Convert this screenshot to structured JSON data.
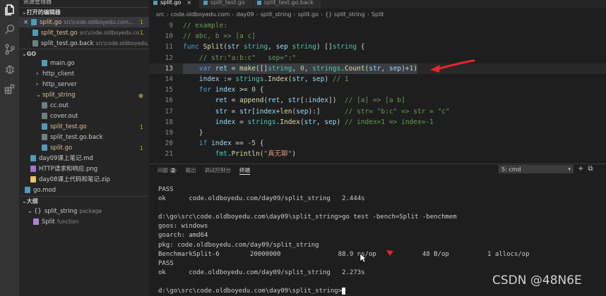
{
  "explorer": {
    "title": "资源管理器",
    "open_editors": {
      "header": "打开的编辑器",
      "items": [
        {
          "name": "split.go",
          "path": "src\\code.oldboyedu.com...",
          "badge": "1",
          "selected": true,
          "icon": "go-file-icon"
        },
        {
          "name": "split_test.go",
          "path": "src\\code.oldboyedu.co...",
          "badge": "1",
          "icon": "go-file-icon"
        },
        {
          "name": "split_test.go.back",
          "path": "src\\code.oldboyedu.com...",
          "badge": "",
          "icon": "file-icon"
        }
      ]
    },
    "workspace": {
      "header": "GO",
      "items": [
        {
          "name": "main.go",
          "type": "go",
          "indent": 3
        },
        {
          "name": "http_client",
          "type": "folder",
          "indent": 2
        },
        {
          "name": "http_server",
          "type": "folder",
          "indent": 2
        },
        {
          "name": "split_string",
          "type": "folder-open",
          "indent": 2,
          "dot": "●",
          "mod": true
        },
        {
          "name": "cc.out",
          "type": "file",
          "indent": 3
        },
        {
          "name": "cover.out",
          "type": "file",
          "indent": 3
        },
        {
          "name": "split_test.go",
          "type": "go",
          "indent": 3,
          "badge": "1",
          "mod": true
        },
        {
          "name": "split_test.go.back",
          "type": "file",
          "indent": 3
        },
        {
          "name": "split.go",
          "type": "go",
          "indent": 3,
          "badge": "1",
          "mod": true
        },
        {
          "name": "day09课上笔记.md",
          "type": "md",
          "indent": 1
        },
        {
          "name": "HTTP请求和响应.png",
          "type": "img",
          "indent": 1
        },
        {
          "name": "day08课上代码和笔记.zip",
          "type": "zip",
          "indent": 1
        },
        {
          "name": "go.mod",
          "type": "go",
          "indent": 0
        }
      ]
    },
    "outline": {
      "header": "大纲",
      "items": [
        {
          "name": "split_string",
          "kind": "package",
          "indent": 1
        },
        {
          "name": "Split",
          "kind": "function",
          "indent": 2
        }
      ]
    }
  },
  "tabs": [
    {
      "label": "split.go",
      "active": true,
      "close": "×"
    },
    {
      "label": "split_test.go",
      "active": false
    },
    {
      "label": "split_test.go.back",
      "active": false
    }
  ],
  "breadcrumb": [
    "src",
    "code.oldboyedu.com",
    "day09",
    "split_string",
    "split.go",
    "{} split_string",
    "Split"
  ],
  "code_lines": [
    {
      "n": "9",
      "segs": [
        [
          "cm",
          "// example:"
        ]
      ]
    },
    {
      "n": "10",
      "segs": [
        [
          "cm",
          "// abc, b => [a c]"
        ]
      ]
    },
    {
      "n": "11",
      "segs": [
        [
          "k",
          "func "
        ],
        [
          "f",
          "Split"
        ],
        [
          "p",
          "("
        ],
        [
          "v",
          "str "
        ],
        [
          "t",
          "string"
        ],
        [
          "p",
          ", "
        ],
        [
          "v",
          "sep "
        ],
        [
          "t",
          "string"
        ],
        [
          "p",
          ") []"
        ],
        [
          "t",
          "string"
        ],
        [
          "p",
          " {"
        ]
      ]
    },
    {
      "n": "12",
      "segs": [
        [
          "p",
          "    "
        ],
        [
          "cm",
          "// str:\"a:b:c\"   sep=\":\""
        ]
      ]
    },
    {
      "n": "13",
      "cur": true,
      "segs": [
        [
          "p",
          "    "
        ],
        [
          "k",
          "var "
        ],
        [
          "v",
          "ret "
        ],
        [
          "p",
          "= "
        ],
        [
          "f",
          "make"
        ],
        [
          "p",
          "([]"
        ],
        [
          "t",
          "string"
        ],
        [
          "p",
          ", "
        ],
        [
          "n",
          "0"
        ],
        [
          "p",
          ", "
        ],
        [
          "t",
          "strings"
        ],
        [
          "p",
          "."
        ],
        [
          "f",
          "Count"
        ],
        [
          "p",
          "("
        ],
        [
          "v",
          "str"
        ],
        [
          "p",
          ", "
        ],
        [
          "v",
          "sep"
        ],
        [
          "p",
          ")+"
        ],
        [
          "n",
          "1"
        ],
        [
          "p",
          ")"
        ]
      ]
    },
    {
      "n": "14",
      "segs": [
        [
          "p",
          "    "
        ],
        [
          "v",
          "index "
        ],
        [
          "p",
          ":= "
        ],
        [
          "t",
          "strings"
        ],
        [
          "p",
          "."
        ],
        [
          "f",
          "Index"
        ],
        [
          "p",
          "("
        ],
        [
          "v",
          "str"
        ],
        [
          "p",
          ", "
        ],
        [
          "v",
          "sep"
        ],
        [
          "p",
          ") "
        ],
        [
          "cm",
          "// 1"
        ]
      ]
    },
    {
      "n": "15",
      "segs": [
        [
          "p",
          "    "
        ],
        [
          "k",
          "for "
        ],
        [
          "v",
          "index "
        ],
        [
          "p",
          ">= "
        ],
        [
          "n",
          "0"
        ],
        [
          "p",
          " {"
        ]
      ]
    },
    {
      "n": "16",
      "segs": [
        [
          "p",
          "        "
        ],
        [
          "v",
          "ret "
        ],
        [
          "p",
          "= "
        ],
        [
          "f",
          "append"
        ],
        [
          "p",
          "("
        ],
        [
          "v",
          "ret"
        ],
        [
          "p",
          ", "
        ],
        [
          "v",
          "str"
        ],
        [
          "p",
          "[:"
        ],
        [
          "v",
          "index"
        ],
        [
          "p",
          "])  "
        ],
        [
          "cm",
          "// [a] => [a b]"
        ]
      ]
    },
    {
      "n": "17",
      "segs": [
        [
          "p",
          "        "
        ],
        [
          "v",
          "str "
        ],
        [
          "p",
          "= "
        ],
        [
          "v",
          "str"
        ],
        [
          "p",
          "["
        ],
        [
          "v",
          "index"
        ],
        [
          "p",
          "+"
        ],
        [
          "f",
          "len"
        ],
        [
          "p",
          "("
        ],
        [
          "v",
          "sep"
        ],
        [
          "p",
          "):]      "
        ],
        [
          "cm",
          "// str= \"b:c\" => str = \"c\""
        ]
      ]
    },
    {
      "n": "18",
      "segs": [
        [
          "p",
          "        "
        ],
        [
          "v",
          "index "
        ],
        [
          "p",
          "= "
        ],
        [
          "t",
          "strings"
        ],
        [
          "p",
          "."
        ],
        [
          "f",
          "Index"
        ],
        [
          "p",
          "("
        ],
        [
          "v",
          "str"
        ],
        [
          "p",
          ", "
        ],
        [
          "v",
          "sep"
        ],
        [
          "p",
          ") "
        ],
        [
          "cm",
          "// index=1 => index=-1"
        ]
      ]
    },
    {
      "n": "19",
      "segs": [
        [
          "p",
          "    }"
        ]
      ]
    },
    {
      "n": "20",
      "segs": [
        [
          "p",
          "    "
        ],
        [
          "k",
          "if "
        ],
        [
          "v",
          "index "
        ],
        [
          "p",
          "== "
        ],
        [
          "n",
          "-5"
        ],
        [
          "p",
          " {"
        ]
      ]
    },
    {
      "n": "21",
      "segs": [
        [
          "p",
          "        "
        ],
        [
          "t",
          "fmt"
        ],
        [
          "p",
          "."
        ],
        [
          "f",
          "Println"
        ],
        [
          "p",
          "("
        ],
        [
          "s",
          "\"真无聊\""
        ],
        [
          "p",
          ")"
        ]
      ]
    }
  ],
  "panel": {
    "tabs": [
      {
        "label": "问题",
        "count": "2"
      },
      {
        "label": "输出"
      },
      {
        "label": "调试控制台"
      },
      {
        "label": "终端",
        "active": true
      }
    ],
    "terminal_select": "5: cmd",
    "buttons": [
      "+",
      "⧉"
    ]
  },
  "terminal_lines": [
    "PASS",
    "ok      code.oldboyedu.com/day09/split_string   2.444s",
    "",
    "d:\\go\\src\\code.oldboyedu.com\\day09\\split_string>go test -bench=Split -benchmem",
    "goos: windows",
    "goarch: amd64",
    "pkg: code.oldboyedu.com/day09/split_string",
    "BenchmarkSplit-6        20000000               88.9 ns/op            48 B/op          1 allocs/op",
    "PASS",
    "ok      code.oldboyedu.com/day09/split_string   2.273s",
    "",
    "d:\\go\\src\\code.oldboyedu.com\\day09\\split_string>"
  ],
  "watermark": "CSDN @48N6E",
  "colors": {
    "accent": "#007acc",
    "annotation_red": "#e5262a"
  }
}
